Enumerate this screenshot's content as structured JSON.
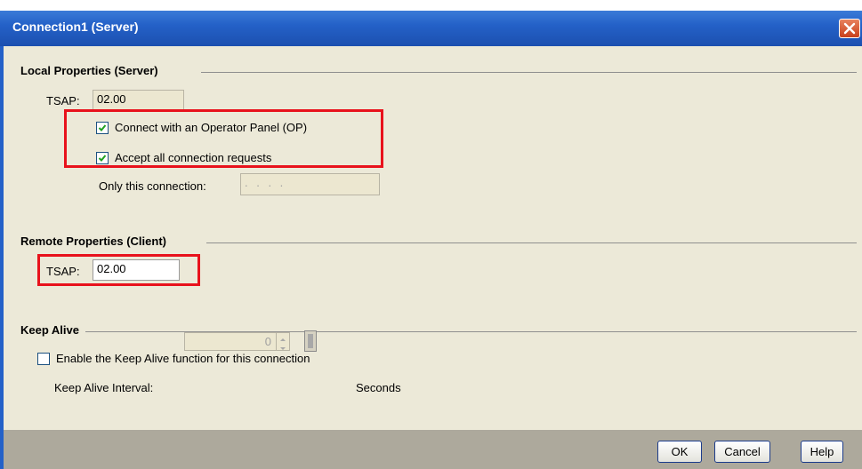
{
  "window": {
    "title": "Connection1 (Server)"
  },
  "local": {
    "section_title": "Local Properties (Server)",
    "tsap_label": "TSAP:",
    "tsap_value": "02.00",
    "connect_op_label": "Connect with an Operator Panel (OP)",
    "connect_op_checked": true,
    "accept_all_label": "Accept all connection requests",
    "accept_all_checked": true,
    "only_this_label": "Only this connection:",
    "only_this_value": ". . . ."
  },
  "remote": {
    "section_title": "Remote Properties (Client)",
    "tsap_label": "TSAP:",
    "tsap_value": "02.00"
  },
  "keepalive": {
    "section_title": "Keep Alive",
    "enable_label": "Enable the Keep Alive function for this connection",
    "enable_checked": false,
    "interval_label": "Keep Alive  Interval:",
    "interval_value": "0",
    "unit_label": "Seconds"
  },
  "buttons": {
    "ok": "OK",
    "cancel": "Cancel",
    "help": "Help"
  },
  "colors": {
    "titlebar": "#2461c8",
    "highlight": "#e8121c",
    "panel": "#ece9d8",
    "footer": "#ada99c"
  }
}
